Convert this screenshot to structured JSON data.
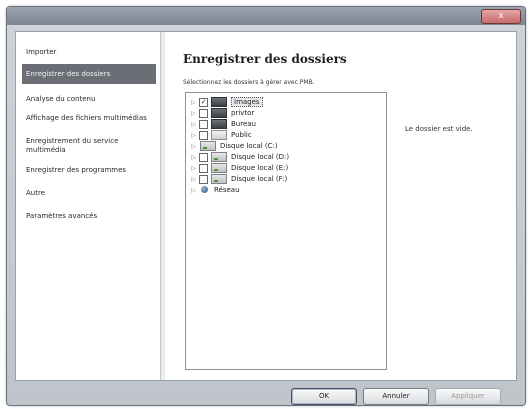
{
  "window": {
    "title": "",
    "close_label": "x"
  },
  "sidebar": {
    "items": [
      {
        "label": "Importer"
      },
      {
        "label": "Enregistrer des dossiers",
        "selected": true
      },
      {
        "label": "Analyse du contenu"
      },
      {
        "label": "Affichage des fichiers multimédias"
      },
      {
        "label": "Enregistrement du service multimédia"
      },
      {
        "label": "Enregistrer des programmes"
      },
      {
        "label": "Autre"
      },
      {
        "label": "Paramètres avancés"
      }
    ]
  },
  "main": {
    "title": "Enregistrer des dossiers",
    "instruction": "Sélectionnez les dossiers à gérer avec PMB.",
    "empty_message": "Le dossier est vide.",
    "tree": [
      {
        "label": "Images",
        "checked": true,
        "icon": "folder-dark-icon",
        "selected": true
      },
      {
        "label": "privtor",
        "checked": false,
        "icon": "folder-dark-icon"
      },
      {
        "label": "Bureau",
        "checked": false,
        "icon": "folder-dark-icon"
      },
      {
        "label": "Public",
        "checked": false,
        "icon": "folder-light-icon"
      },
      {
        "label": "Disque local (C:)",
        "checked": false,
        "icon": "drive-icon"
      },
      {
        "label": "Disque local (D:)",
        "checked": false,
        "icon": "drive-icon"
      },
      {
        "label": "Disque local (E:)",
        "checked": false,
        "icon": "drive-icon"
      },
      {
        "label": "Disque local (F:)",
        "checked": false,
        "icon": "drive-icon"
      },
      {
        "label": "Réseau",
        "checked": false,
        "icon": "network-icon"
      }
    ]
  },
  "buttons": {
    "ok": "OK",
    "cancel": "Annuler",
    "apply": "Appliquer"
  }
}
